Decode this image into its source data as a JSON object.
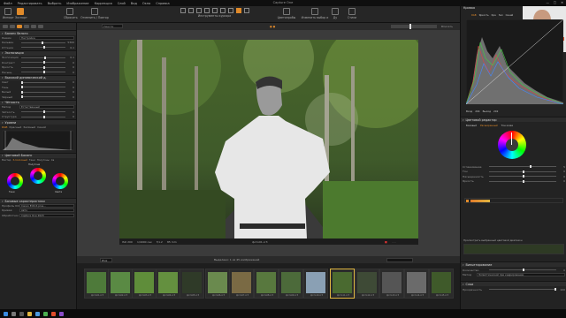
{
  "app": {
    "title": "Capture One",
    "menu": [
      "Файл",
      "Редактировать",
      "Выбрать",
      "Изображение",
      "Коррекция",
      "Слой",
      "Вид",
      "Окно",
      "Справка"
    ]
  },
  "toolbar": {
    "import": "Импорт",
    "export": "Экспорт",
    "reset": "Сбросить",
    "undo_redo": "Отменить / Повтор",
    "cursor_tools": "Инструменты курсора",
    "cursor_select": "Цветопробы",
    "copy_apply": "Изменить выбор и",
    "apply": "Ду",
    "presets": "Стили"
  },
  "viewer": {
    "zoom_label": "Вписать",
    "fit": "Умести",
    "filename": "фото01.cr3",
    "exif": {
      "iso": "ISO 200",
      "shutter": "1/4000 сек",
      "aperture": "f/1.2",
      "focal": "85 mm"
    }
  },
  "left_panel": {
    "basic": {
      "title": "Баланс белого",
      "rows": [
        {
          "label": "Режим",
          "value": "Настройка"
        },
        {
          "label": "Кельвин",
          "value": "5300"
        },
        {
          "label": "Оттенок",
          "value": "0,1"
        }
      ]
    },
    "exposure": {
      "title": "Экспозиция",
      "rows": [
        {
          "label": "Экспозиция",
          "value": "0,1"
        },
        {
          "label": "Контраст",
          "value": "0"
        },
        {
          "label": "Яркость",
          "value": "0"
        },
        {
          "label": "Насыщ.",
          "value": "0"
        }
      ]
    },
    "hdr": {
      "title": "Высокий динамический д.",
      "rows": [
        {
          "label": "Свет",
          "value": "0"
        },
        {
          "label": "Тень",
          "value": "0"
        },
        {
          "label": "Белый",
          "value": "0"
        },
        {
          "label": "Чёрный",
          "value": "0"
        }
      ]
    },
    "clarity": {
      "title": "Чёткость",
      "rows": [
        {
          "label": "Метод",
          "value": "Естественный"
        },
        {
          "label": "Чёткость",
          "value": "0"
        },
        {
          "label": "Структура",
          "value": "0"
        }
      ]
    },
    "levels": {
      "title": "Уровни",
      "tabs": [
        "RGB",
        "Красный",
        "Зелёный",
        "Синий"
      ]
    },
    "balance": {
      "title": "Цветовой Баланс",
      "tabs": [
        "Мастер",
        "3-полосный",
        "Тени",
        "Полутоны",
        "Св"
      ],
      "wheels": [
        "Тени",
        "Полутона",
        "Света"
      ]
    },
    "meta": {
      "title": "Базовые характеристики",
      "rows": [
        {
          "label": "Профиль ICC",
          "value": "Canon EOS R plus..."
        },
        {
          "label": "Кривая",
          "value": "Авто"
        },
        {
          "label": "Обработчик",
          "value": "Capture One 2023"
        }
      ]
    }
  },
  "right_panel": {
    "histogram": {
      "title": "Кривая",
      "tabs": [
        "RGB",
        "Яркость",
        "Кра",
        "Зел",
        "Синий"
      ],
      "input_label": "Вход",
      "input_value": "204",
      "output_label": "Выход",
      "output_value": "202"
    },
    "color_editor": {
      "title": "Цветовой редактор",
      "tabs": [
        "Базовый",
        "Расширенный",
        "Тон кожи"
      ],
      "rows": [
        {
          "label": "Сглаживание",
          "value": "5"
        },
        {
          "label": "Тон",
          "value": "0"
        },
        {
          "label": "Насыщенность",
          "value": "0"
        },
        {
          "label": "Яркость",
          "value": "0"
        }
      ]
    },
    "selection": {
      "label": "Просмотреть выбранный цветовой диапазон"
    },
    "vignette": {
      "title": "Виньетирование",
      "rows": [
        {
          "label": "Количество",
          "value": "0"
        },
        {
          "label": "Метод",
          "value": "Эллиптический при кадрировании"
        }
      ]
    },
    "layers": {
      "title": "Слои",
      "rows": [
        {
          "label": "Прозрачность",
          "value": "100"
        }
      ]
    }
  },
  "filmstrip": {
    "mode": "Имя",
    "selected_text": "Выделено: 1 из 45 изображений",
    "search_placeholder": "",
    "thumbs": [
      "фото01.cr3",
      "фото02.cr3",
      "фото03.cr3",
      "фото04.cr3",
      "фото05.cr3",
      "фото06.cr3",
      "фото07.cr3",
      "фото08.cr3",
      "фото09.cr3",
      "фото10.cr3",
      "фото11.cr3",
      "фото12.cr3",
      "фото13.cr3",
      "фото14.cr3",
      "фото15.cr3",
      "фото16.cr3"
    ]
  },
  "watermark": {
    "text1": "УРОКИ",
    "text2": "ФОТОГРАФИИ"
  },
  "colors": {
    "accent": "#e08a2a",
    "select": "#e0b640"
  }
}
